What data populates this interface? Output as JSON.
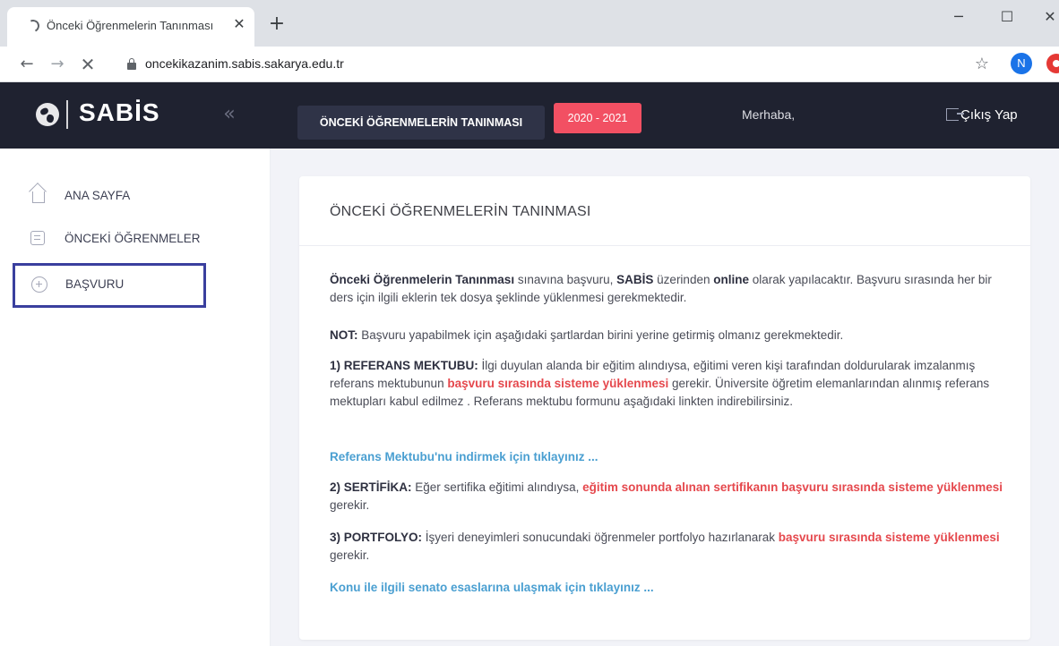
{
  "browser": {
    "tab_title": "Önceki Öğrenmelerin Tanınması",
    "tab_close": "✕",
    "new_tab": "+",
    "url": "oncekikazanim.sabis.sakarya.edu.tr",
    "profile_initial": "N",
    "window_controls": {
      "minimize": "─",
      "maximize": "☐",
      "close": "✕"
    },
    "nav": {
      "back": "←",
      "forward": "→",
      "stop": "✕",
      "bookmark": "☆"
    }
  },
  "header": {
    "logo": "SABİS",
    "collapse_icon": "«",
    "section_title": "ÖNCEKİ ÖĞRENMELERİN TANINMASI",
    "year": "2020 - 2021",
    "greeting": "Merhaba,",
    "logout": "Çıkış Yap"
  },
  "sidebar": {
    "items": [
      {
        "label": "ANA SAYFA",
        "icon": "home-icon"
      },
      {
        "label": "ÖNCEKİ ÖĞRENMELER",
        "icon": "document-icon"
      },
      {
        "label": "BAŞVURU",
        "icon": "plus-circle-icon"
      }
    ]
  },
  "card": {
    "title": "ÖNCEKİ ÖĞRENMELERİN TANINMASI",
    "p1": {
      "b1": "Önceki Öğrenmelerin Tanınması",
      "t1": " sınavına başvuru, ",
      "b2": "SABİS",
      "t2": " üzerinden ",
      "b3": "online",
      "t3": " olarak yapılacaktır. Başvuru sırasında her bir ders için ilgili eklerin tek dosya şeklinde yüklenmesi gerekmektedir."
    },
    "p2": {
      "b1": "NOT:",
      "t1": " Başvuru yapabilmek için aşağıdaki şartlardan birini yerine getirmiş olmanız gerekmektedir."
    },
    "p3": {
      "b1": "1) REFERANS MEKTUBU:",
      "t1": " İlgi duyulan alanda bir eğitim alındıysa, eğitimi veren kişi tarafından doldurularak imzalanmış referans mektubunun ",
      "r1": "başvuru sırasında sisteme yüklenmesi",
      "t2": " gerekir. Üniversite öğretim elemanlarından alınmış referans mektupları kabul edilmez . Referans mektubu formunu aşağıdaki linkten indirebilirsiniz."
    },
    "link1": "Referans Mektubu'nu indirmek için tıklayınız ...",
    "p5": {
      "b1": "2) SERTİFİKA:",
      "t1": " Eğer sertifika eğitimi alındıysa, ",
      "r1": "eğitim sonunda alınan sertifikanın başvuru sırasında sisteme yüklenmesi",
      "t2": " gerekir."
    },
    "p6": {
      "b1": "3) PORTFOLYO:",
      "t1": " İşyeri deneyimleri sonucundaki öğrenmeler portfolyo hazırlanarak ",
      "r1": "başvuru sırasında sisteme yüklenmesi",
      "t2": " gerekir."
    },
    "link2": "Konu ile ilgili senato esaslarına ulaşmak için tıklayınız ..."
  },
  "colors": {
    "header_bg": "#1f2230",
    "title_button_bg": "#2f3347",
    "year_badge_bg": "#f25063",
    "highlight_red": "#e5484d",
    "link_blue": "#4a9fd1",
    "selected_outline": "#3a3f9e",
    "page_bg": "#f2f3f8"
  }
}
